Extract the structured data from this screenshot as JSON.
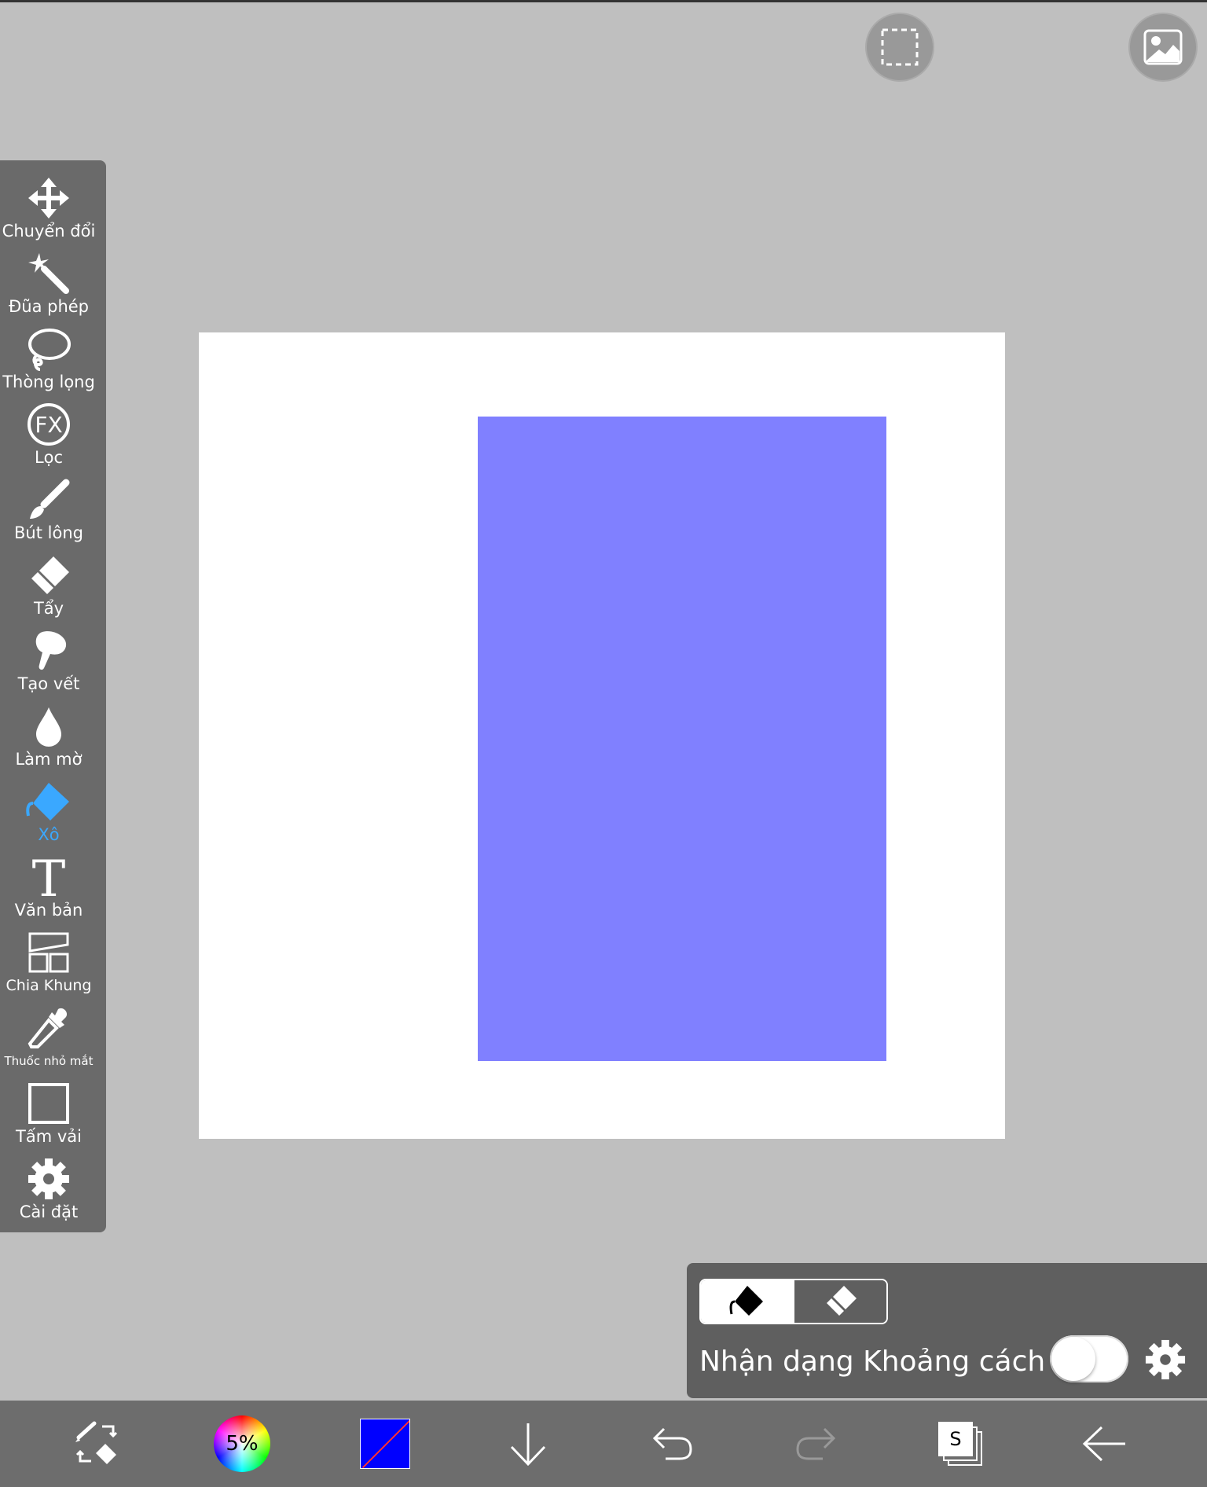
{
  "toolbar": {
    "items": [
      {
        "label": "Chuyển đổi",
        "icon": "move-icon"
      },
      {
        "label": "Đũa phép",
        "icon": "magic-wand-icon"
      },
      {
        "label": "Thòng lọng",
        "icon": "lasso-icon"
      },
      {
        "label": "Lọc",
        "icon": "fx-filter-icon"
      },
      {
        "label": "Bút lông",
        "icon": "brush-icon"
      },
      {
        "label": "Tẩy",
        "icon": "eraser-icon"
      },
      {
        "label": "Tạo vết",
        "icon": "smudge-icon"
      },
      {
        "label": "Làm mờ",
        "icon": "blur-drop-icon"
      },
      {
        "label": "Xô",
        "icon": "bucket-icon",
        "active": true
      },
      {
        "label": "Văn bản",
        "icon": "text-icon"
      },
      {
        "label": "Chia Khung",
        "icon": "frame-divider-icon"
      },
      {
        "label": "Thuốc nhỏ mắt",
        "icon": "eyedropper-icon"
      },
      {
        "label": "Tấm vải",
        "icon": "canvas-icon"
      },
      {
        "label": "Cài đặt",
        "icon": "gear-icon"
      }
    ],
    "active_color": "#3aa8ff"
  },
  "bucket_panel": {
    "option_label": "Nhận dạng Khoảng cách",
    "toggle_on": false
  },
  "bottom_bar": {
    "color_wheel_label": "5%",
    "layers_label": "S",
    "current_color": "#0000ff"
  },
  "canvas": {
    "background": "#ffffff",
    "fill_color": "#8080ff"
  }
}
